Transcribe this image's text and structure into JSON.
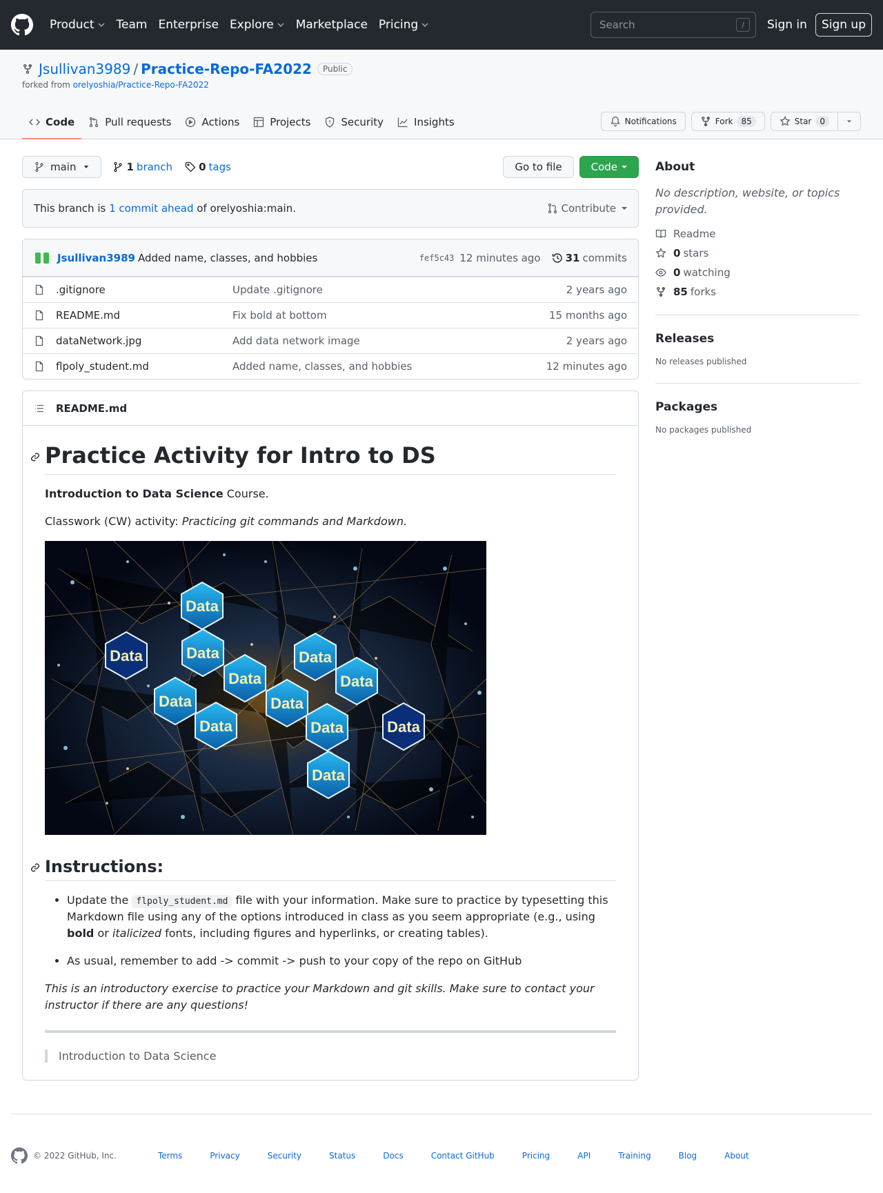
{
  "header": {
    "nav": [
      "Product",
      "Team",
      "Enterprise",
      "Explore",
      "Marketplace",
      "Pricing"
    ],
    "search_placeholder": "Search",
    "search_key": "/",
    "signin": "Sign in",
    "signup": "Sign up"
  },
  "repo": {
    "owner": "Jsullivan3989",
    "sep": "/",
    "name": "Practice-Repo-FA2022",
    "visibility": "Public",
    "forked_prefix": "forked from",
    "forked_from": "orelyoshia/Practice-Repo-FA2022",
    "notifications": "Notifications",
    "fork_label": "Fork",
    "fork_count": "85",
    "star_label": "Star",
    "star_count": "0"
  },
  "tabs": [
    "Code",
    "Pull requests",
    "Actions",
    "Projects",
    "Security",
    "Insights"
  ],
  "filenav": {
    "branch": "main",
    "branch_count": "1",
    "branch_label": "branch",
    "tag_count": "0",
    "tag_label": "tags",
    "goto": "Go to file",
    "code": "Code"
  },
  "ahead": {
    "prefix": "This branch is",
    "link": "1 commit ahead",
    "suffix": "of orelyoshia:main.",
    "contribute": "Contribute"
  },
  "commit": {
    "author": "Jsullivan3989",
    "message": "Added name, classes, and hobbies",
    "sha": "fef5c43",
    "time": "12 minutes ago",
    "count": "31",
    "count_label": "commits"
  },
  "files": [
    {
      "name": ".gitignore",
      "msg": "Update .gitignore",
      "time": "2 years ago"
    },
    {
      "name": "README.md",
      "msg": "Fix bold at bottom",
      "time": "15 months ago"
    },
    {
      "name": "dataNetwork.jpg",
      "msg": "Add data network image",
      "time": "2 years ago"
    },
    {
      "name": "flpoly_student.md",
      "msg": "Added name, classes, and hobbies",
      "time": "12 minutes ago"
    }
  ],
  "readme": {
    "filename": "README.md",
    "h1": "Practice Activity for Intro to DS",
    "p1_bold": "Introduction to Data Science",
    "p1_rest": " Course.",
    "p2_prefix": "Classwork (CW) activity: ",
    "p2_italic": "Practicing git commands and Markdown.",
    "image_word": "Data",
    "h2": "Instructions:",
    "li1_a": "Update the ",
    "li1_code": "flpoly_student.md",
    "li1_b": " file with your information. Make sure to practice by typesetting this Markdown file using any of the options introduced in class as you seem appropriate (e.g., using ",
    "li1_bold": "bold",
    "li1_c": " or ",
    "li1_italic": "italicized",
    "li1_d": " fonts, including figures and hyperlinks, or creating tables).",
    "li2": "As usual, remember to add -> commit -> push to your copy of the repo on GitHub",
    "p3": "This is an introductory exercise to practice your Markdown and git skills. Make sure to contact your instructor if there are any questions!",
    "quote": "Introduction to Data Science"
  },
  "sidebar": {
    "about_title": "About",
    "about_desc": "No description, website, or topics provided.",
    "readme": "Readme",
    "stars_count": "0",
    "stars_label": "stars",
    "watching_count": "0",
    "watching_label": "watching",
    "forks_count": "85",
    "forks_label": "forks",
    "releases_title": "Releases",
    "releases_text": "No releases published",
    "packages_title": "Packages",
    "packages_text": "No packages published"
  },
  "footer": {
    "copyright": "© 2022 GitHub, Inc.",
    "links": [
      "Terms",
      "Privacy",
      "Security",
      "Status",
      "Docs",
      "Contact GitHub",
      "Pricing",
      "API",
      "Training",
      "Blog",
      "About"
    ]
  }
}
